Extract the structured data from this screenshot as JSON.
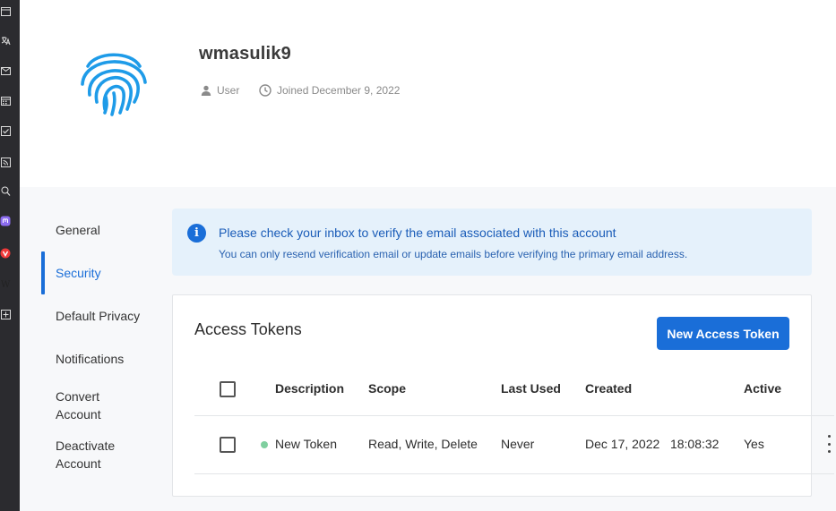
{
  "profile": {
    "username": "wmasulik9",
    "role": "User",
    "joined": "Joined December 9, 2022"
  },
  "nav": {
    "items": [
      {
        "label": "General"
      },
      {
        "label": "Security",
        "active": true
      },
      {
        "label": "Default Privacy"
      },
      {
        "label": "Notifications"
      },
      {
        "label": "Convert Account"
      },
      {
        "label": "Deactivate Account"
      }
    ]
  },
  "alert": {
    "title": "Please check your inbox to verify the email associated with this account",
    "subtitle": "You can only resend verification email or update emails before verifying the primary email address."
  },
  "tokens": {
    "title": "Access Tokens",
    "new_button": "New Access Token",
    "columns": [
      "Description",
      "Scope",
      "Last Used",
      "Created",
      "Active"
    ],
    "rows": [
      {
        "description": "New Token",
        "scope": "Read, Write, Delete",
        "last_used": "Never",
        "created": "Dec 17, 2022   18:08:32",
        "active": "Yes"
      }
    ]
  },
  "colors": {
    "accent": "#1a6ed8",
    "alert_bg": "#e5f1fb",
    "status_active": "#7fcf9f",
    "fingerprint": "#1e9be8"
  },
  "icons": {
    "strip": [
      "window-icon",
      "translate-icon",
      "mail-icon",
      "calendar-icon",
      "tasks-icon",
      "feed-icon",
      "reader-icon",
      "mastodon-icon",
      "vivaldi-icon",
      "wikipedia-icon",
      "add-panel-icon"
    ],
    "fingerprint": "fingerprint-icon",
    "role": "user-icon",
    "joined": "clock-icon",
    "info": "info-icon",
    "kebab": "more-vertical-icon"
  }
}
